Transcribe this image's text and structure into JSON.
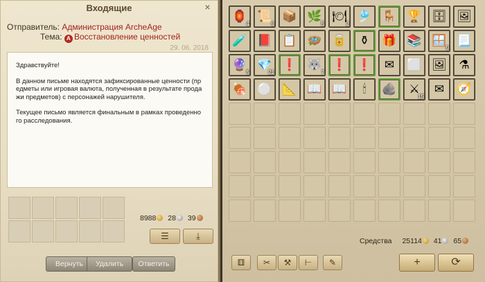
{
  "mail": {
    "title": "Входящие",
    "close_icon": "×",
    "sender_label": "Отправитель:",
    "sender": "Администрация ArcheAge",
    "subject_label": "Тема:",
    "subject_icon": "A",
    "subject": "Восстановление ценностей",
    "date": "29. 06. 2018",
    "body": [
      "Здравствуйте!",
      "В данном письме находятся зафиксированные ценности (пр едметы или игровая валюта, полученная в результате прода жи предметов) с персонажей нарушителя.",
      "Текущее письмо является финальным в рамках проведенно го расследования."
    ],
    "money": {
      "gold": "8988",
      "silver": "28",
      "copper": "39"
    },
    "buttons": {
      "return": "Вернуть",
      "delete": "Удалить",
      "reply": "Ответить"
    }
  },
  "inventory": {
    "funds_label": "Средства",
    "funds": {
      "gold": "25114",
      "silver": "41",
      "copper": "65"
    },
    "items": [
      {
        "icon": "🏮",
        "count": "4",
        "green": false
      },
      {
        "icon": "📜",
        "count": "9",
        "green": false
      },
      {
        "icon": "📦",
        "count": "",
        "green": false
      },
      {
        "icon": "🌿",
        "count": "5",
        "green": false
      },
      {
        "icon": "🍽",
        "count": "2",
        "green": false
      },
      {
        "icon": "🎐",
        "count": "",
        "green": false
      },
      {
        "icon": "🪑",
        "count": "",
        "green": true
      },
      {
        "icon": "🏆",
        "count": "",
        "green": false
      },
      {
        "icon": "🗄",
        "count": "",
        "green": false
      },
      {
        "icon": "🖼",
        "count": "",
        "green": false
      },
      {
        "icon": "🧪",
        "count": "",
        "green": false
      },
      {
        "icon": "📕",
        "count": "",
        "green": false
      },
      {
        "icon": "📋",
        "count": "",
        "green": false
      },
      {
        "icon": "🪺",
        "count": "",
        "green": false
      },
      {
        "icon": "🥫",
        "count": "",
        "green": false
      },
      {
        "icon": "⚱",
        "count": "",
        "green": true
      },
      {
        "icon": "🎁",
        "count": "",
        "green": false
      },
      {
        "icon": "📚",
        "count": "",
        "green": false
      },
      {
        "icon": "🪟",
        "count": "9",
        "green": false
      },
      {
        "icon": "📃",
        "count": "",
        "green": false
      },
      {
        "icon": "🔮",
        "count": "5",
        "green": false
      },
      {
        "icon": "💎",
        "count": "21",
        "green": false
      },
      {
        "icon": "❗",
        "count": "",
        "green": true
      },
      {
        "icon": "🐺",
        "count": "7",
        "green": false
      },
      {
        "icon": "❗",
        "count": "",
        "green": true
      },
      {
        "icon": "❗",
        "count": "",
        "green": true
      },
      {
        "icon": "✉",
        "count": "",
        "green": false
      },
      {
        "icon": "⬜",
        "count": "",
        "green": false
      },
      {
        "icon": "🖼",
        "count": "",
        "green": false
      },
      {
        "icon": "⚗",
        "count": "",
        "green": false
      },
      {
        "icon": "🍖",
        "count": "",
        "green": false
      },
      {
        "icon": "⚪",
        "count": "",
        "green": false
      },
      {
        "icon": "📐",
        "count": "",
        "green": false
      },
      {
        "icon": "📖",
        "count": "",
        "green": false
      },
      {
        "icon": "📖",
        "count": "",
        "green": false
      },
      {
        "icon": "🕯",
        "count": "",
        "green": false
      },
      {
        "icon": "🪨",
        "count": "",
        "green": true
      },
      {
        "icon": "⚔",
        "count": "15",
        "green": false
      },
      {
        "icon": "✉",
        "count": "",
        "green": false
      },
      {
        "icon": "🧭",
        "count": "",
        "green": false
      }
    ],
    "total_slots": 90,
    "bottom_icons": [
      "⚅",
      "✂",
      "⚒",
      "⊢",
      "✎"
    ],
    "add_icon": "+",
    "refresh_icon": "⟳"
  }
}
